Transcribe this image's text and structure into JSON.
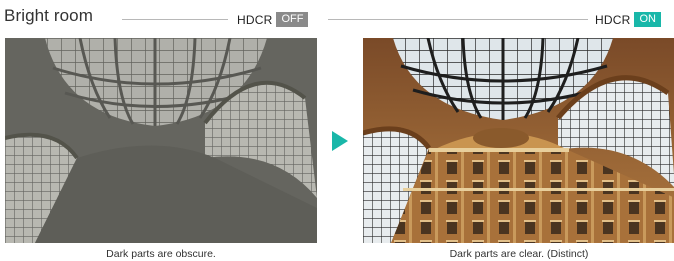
{
  "header": {
    "title": "Bright room"
  },
  "left_panel": {
    "hdcr_label": "HDCR",
    "state": "OFF",
    "caption": "Dark parts are obscure."
  },
  "right_panel": {
    "hdcr_label": "HDCR",
    "state": "ON",
    "caption": "Dark parts are clear. (Distinct)"
  },
  "colors": {
    "accent_on": "#19b7a9",
    "badge_off": "#8a8a8a"
  },
  "icons": {
    "arrow": "play-arrow-icon"
  }
}
